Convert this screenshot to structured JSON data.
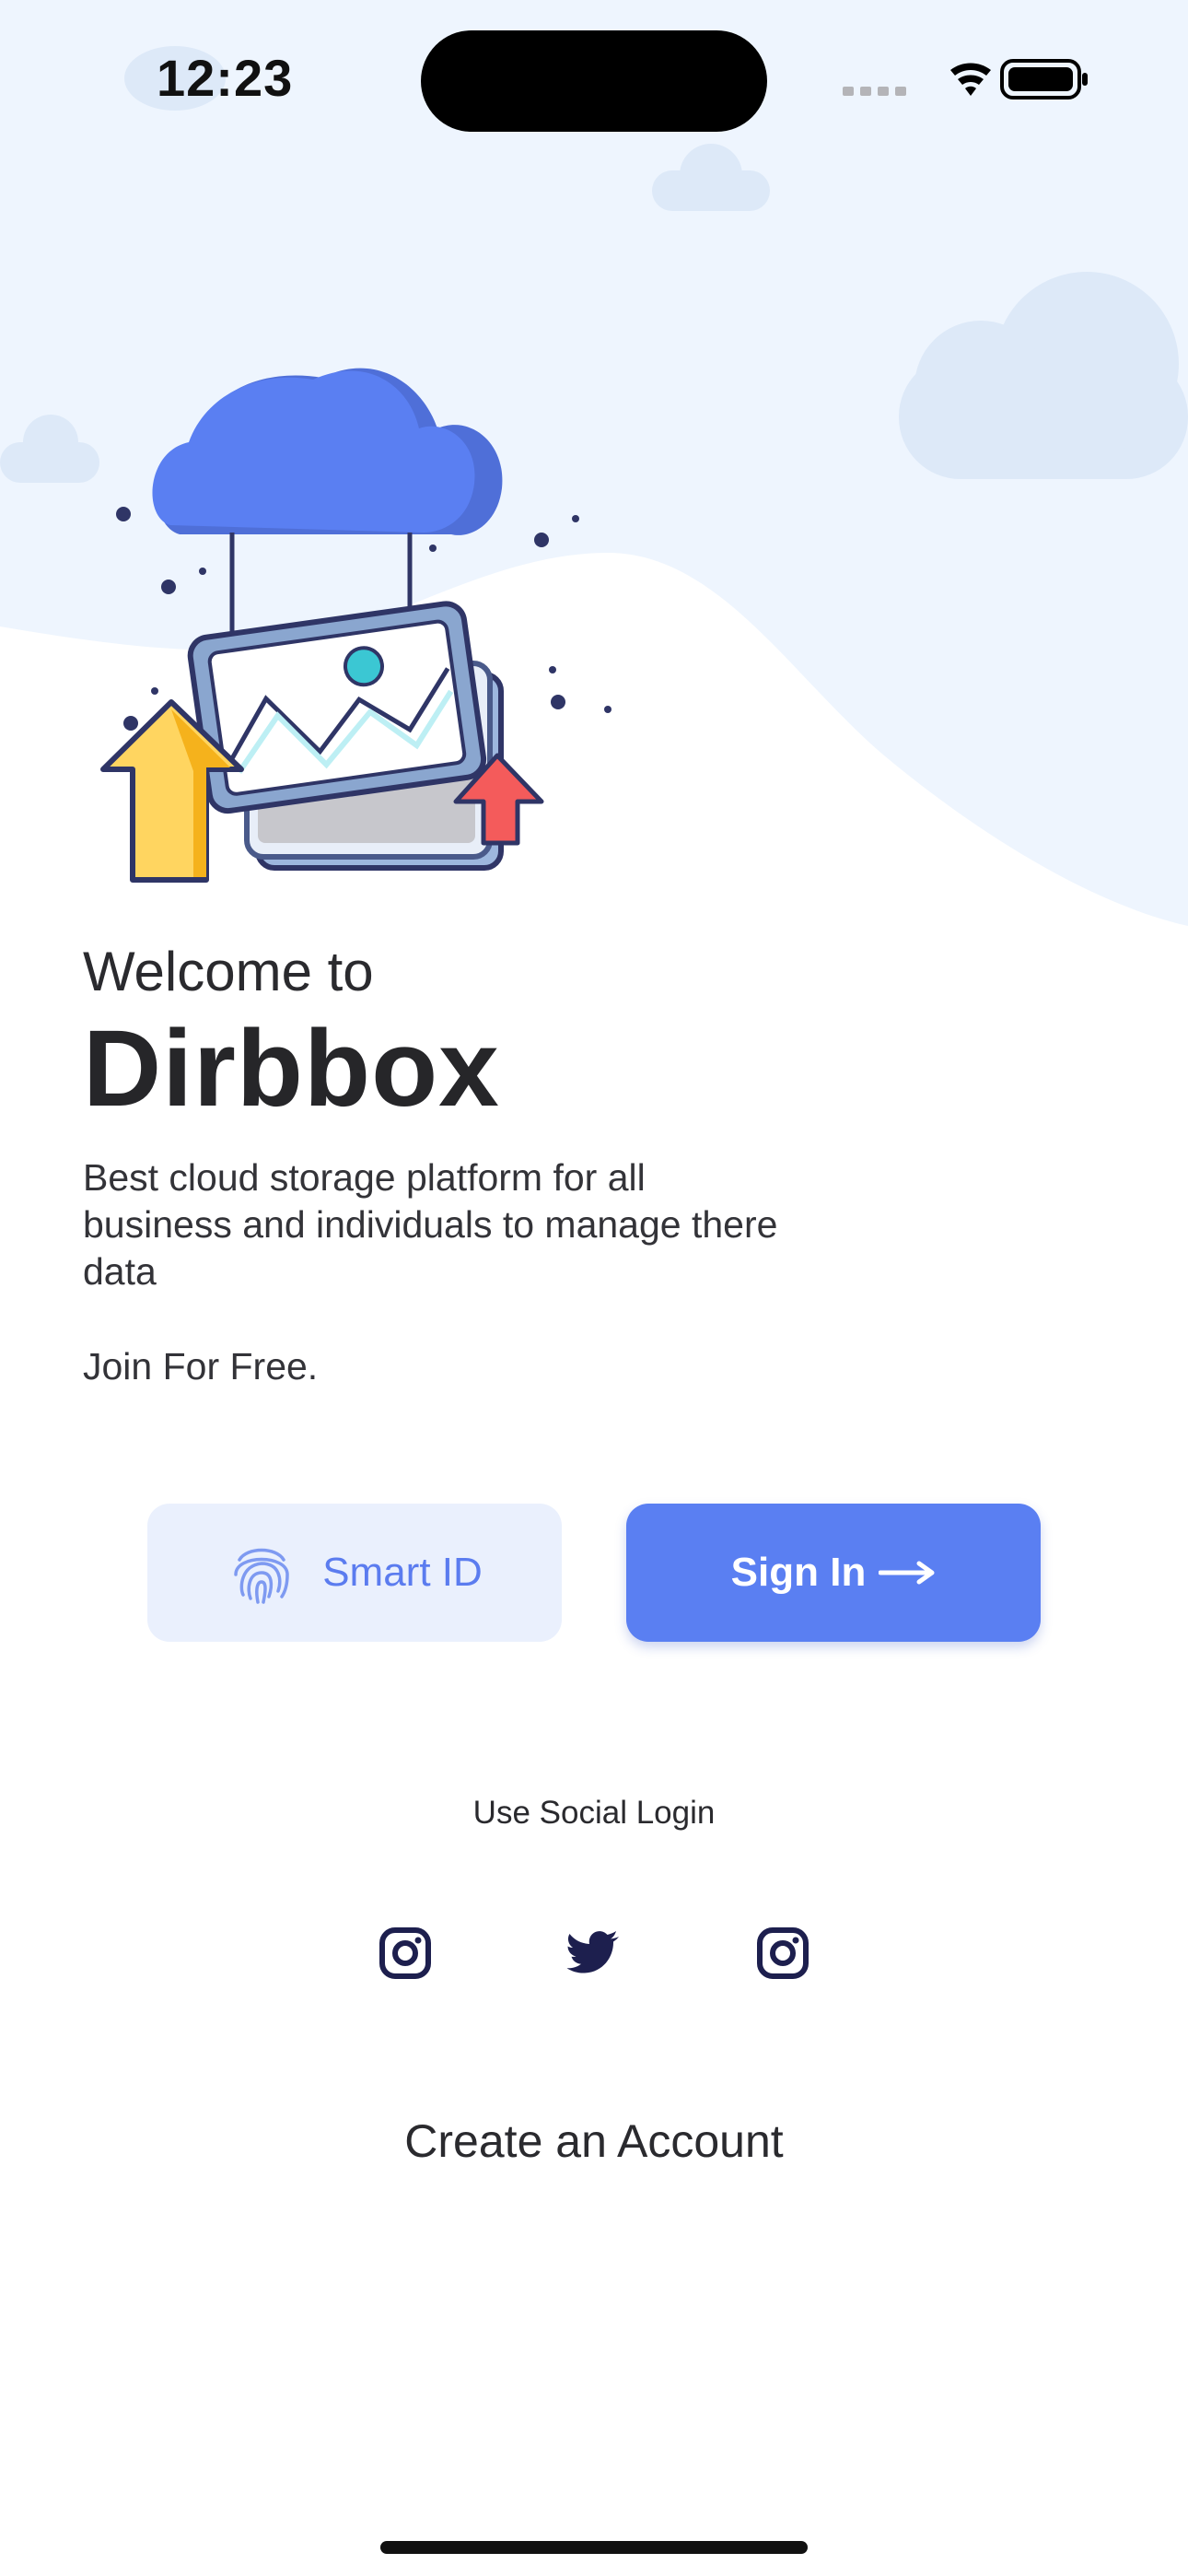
{
  "status_bar": {
    "time": "12:23",
    "icons": [
      "signal-icon",
      "wifi-icon",
      "battery-icon"
    ]
  },
  "hero": {
    "illustration": "cloud-upload-image-illustration"
  },
  "welcome": {
    "line1": "Welcome to",
    "brand": "Dirbbox",
    "description": "Best cloud storage platform for all business and individuals to manage there data",
    "join": "Join For Free."
  },
  "buttons": {
    "smart_id": "Smart ID",
    "smart_id_icon": "fingerprint-icon",
    "sign_in": "Sign In",
    "sign_in_icon": "arrow-right-icon"
  },
  "social": {
    "label": "Use Social Login",
    "icons": [
      "instagram-icon",
      "twitter-icon",
      "instagram-icon"
    ]
  },
  "footer": {
    "create_account": "Create an Account"
  },
  "colors": {
    "primary": "#5a7ff2",
    "primary_soft": "#eaf0fd",
    "background_tint": "#eef5fe",
    "text": "#2a2a2e",
    "arrow_yellow": "#ffd560",
    "arrow_red": "#f45b5b",
    "social_icon": "#1d1f4e"
  }
}
